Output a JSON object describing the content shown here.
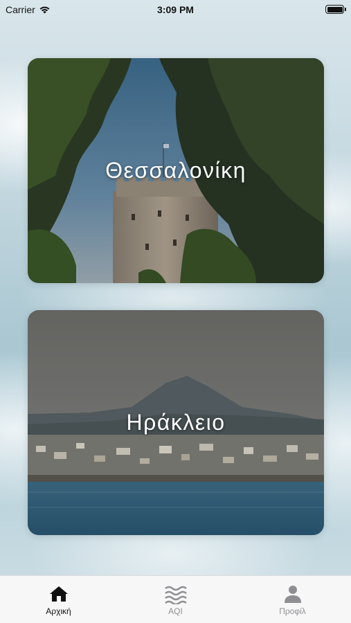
{
  "status_bar": {
    "carrier": "Carrier",
    "time": "3:09 PM",
    "battery_level": 1.0
  },
  "cities": [
    {
      "name": "Θεσσαλονίκη",
      "image": "white-tower-between-pine-trees"
    },
    {
      "name": "Ηράκλειο",
      "image": "heraklion-coastline-with-mountain"
    }
  ],
  "tab_bar": {
    "active_color": "#000000",
    "inactive_color": "#8e8e93",
    "tabs": [
      {
        "label": "Αρχική",
        "icon": "home-icon",
        "active": true
      },
      {
        "label": "AQI",
        "icon": "waves-icon",
        "active": false
      },
      {
        "label": "Προφίλ",
        "icon": "person-icon",
        "active": false
      }
    ]
  }
}
